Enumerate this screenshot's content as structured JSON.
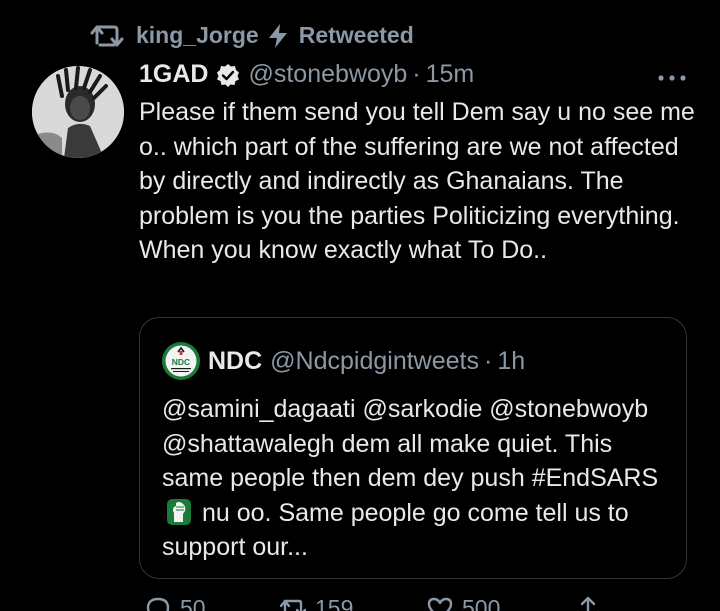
{
  "retweet": {
    "user": "king_Jorge",
    "label": "Retweeted"
  },
  "tweet": {
    "display_name": "1GAD",
    "handle": "@stonebwoyb",
    "separator": "·",
    "time": "15m",
    "text": "Please if them send you tell Dem say u no see me o.. which part of the suffering are we not affected by directly and indirectly as Ghanaians. The problem is you the parties Politicizing everything. When you know exactly what To Do.."
  },
  "quote": {
    "logo_text": "NDC",
    "display_name": "NDC",
    "handle": "@Ndcpidgintweets",
    "separator": "·",
    "time": "1h",
    "text_before": "@samini_dagaati @sarkodie @stonebwoyb @shattawalegh dem all make quiet. This same people then dem dey push #EndSARS",
    "text_after": "nu oo. Same people go come tell us to support our..."
  },
  "actions": {
    "replies": "50",
    "retweets": "159",
    "likes": "500"
  },
  "colors": {
    "background": "#000000",
    "text": "#e7e9ea",
    "muted": "#8b98a5",
    "border": "#333639",
    "ndc_green": "#1a7a3a"
  },
  "icons": {
    "retweet": "retweet-icon",
    "bolt": "lightning-bolt-icon",
    "verified": "verified-badge-icon",
    "more": "more-options-icon",
    "fist": "raised-fist-icon",
    "reply": "reply-icon",
    "like": "heart-icon",
    "share": "share-icon"
  }
}
